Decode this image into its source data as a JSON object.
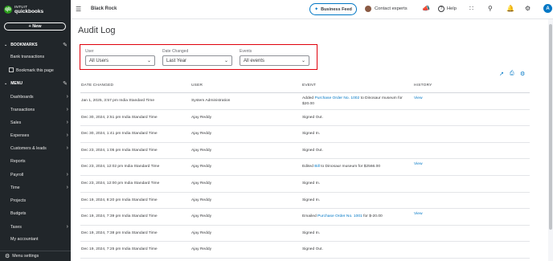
{
  "sidebar": {
    "logo_line1": "INTUIT",
    "logo_line2": "quickbooks",
    "logo_icon": "qb",
    "new_label": "+ New",
    "bookmarks_header": "BOOKMARKS",
    "bookmark_items": [
      "Bank transactions",
      "Bookmark this page"
    ],
    "menu_header": "MENU",
    "menu_items": [
      {
        "label": "Dashboards",
        "arrow": "›"
      },
      {
        "label": "Transactions",
        "arrow": "›"
      },
      {
        "label": "Sales",
        "arrow": "›"
      },
      {
        "label": "Expenses",
        "arrow": "›"
      },
      {
        "label": "Customers & leads",
        "arrow": "›"
      },
      {
        "label": "Reports",
        "arrow": ""
      },
      {
        "label": "Payroll",
        "arrow": "›"
      },
      {
        "label": "Time",
        "arrow": "›"
      },
      {
        "label": "Projects",
        "arrow": ""
      },
      {
        "label": "Budgets",
        "arrow": ""
      },
      {
        "label": "Taxes",
        "arrow": "›"
      },
      {
        "label": "My accountant",
        "arrow": ""
      }
    ],
    "menu_settings": "Menu settings"
  },
  "topbar": {
    "company": "Black Rock",
    "business_feed": "Business Feed",
    "contact_experts": "Contact experts",
    "help": "Help",
    "user_initial": "A",
    "icons": [
      "hamburger-icon",
      "megaphone-icon",
      "grid-icon",
      "search-icon",
      "bell-icon",
      "gear-icon"
    ]
  },
  "page": {
    "title": "Audit Log",
    "filters": {
      "user_label": "User",
      "user_value": "All Users",
      "date_label": "Date Changed",
      "date_value": "Last Year",
      "events_label": "Events",
      "events_value": "All events"
    },
    "columns": [
      "DATE CHANGED",
      "USER",
      "EVENT",
      "HISTORY"
    ],
    "rows": [
      {
        "date": "Jan 1, 2025, 3:57 pm India Standard Time",
        "user": "System Administration",
        "event_pre": "Added ",
        "event_link": "Purchase Order No. 1002",
        "event_post": " to Dinosaur museum for $20.00",
        "history": "View"
      },
      {
        "date": "Dec 30, 2024, 2:51 pm India Standard Time",
        "user": "Ajay Reddy",
        "event_pre": "Signed Out.",
        "event_link": "",
        "event_post": "",
        "history": ""
      },
      {
        "date": "Dec 30, 2024, 1:41 pm India Standard Time",
        "user": "Ajay Reddy",
        "event_pre": "Signed In.",
        "event_link": "",
        "event_post": "",
        "history": ""
      },
      {
        "date": "Dec 23, 2024, 1:05 pm India Standard Time",
        "user": "Ajay Reddy",
        "event_pre": "Signed Out.",
        "event_link": "",
        "event_post": "",
        "history": ""
      },
      {
        "date": "Dec 23, 2024, 12:02 pm India Standard Time",
        "user": "Ajay Reddy",
        "event_pre": "Edited ",
        "event_link": "Bill",
        "event_post": " to Dinosaur museum for $2566.00",
        "history": "View"
      },
      {
        "date": "Dec 23, 2024, 12:00 pm India Standard Time",
        "user": "Ajay Reddy",
        "event_pre": "Signed In.",
        "event_link": "",
        "event_post": "",
        "history": ""
      },
      {
        "date": "Dec 19, 2024, 8:20 pm India Standard Time",
        "user": "Ajay Reddy",
        "event_pre": "Signed In.",
        "event_link": "",
        "event_post": "",
        "history": ""
      },
      {
        "date": "Dec 19, 2024, 7:39 pm India Standard Time",
        "user": "Ajay Reddy",
        "event_pre": "Emailed ",
        "event_link": "Purchase Order No. 1001",
        "event_post": " for $-20.00",
        "history": "View"
      },
      {
        "date": "Dec 19, 2024, 7:38 pm India Standard Time",
        "user": "Ajay Reddy",
        "event_pre": "Signed In.",
        "event_link": "",
        "event_post": "",
        "history": ""
      },
      {
        "date": "Dec 19, 2024, 7:25 pm India Standard Time",
        "user": "Ajay Reddy",
        "event_pre": "Signed Out.",
        "event_link": "",
        "event_post": "",
        "history": ""
      }
    ]
  },
  "colors": {
    "sidebar_bg": "#21262a",
    "accent": "#0077c5",
    "highlight_border": "#e0000c",
    "brand_green": "#2ca01c"
  }
}
